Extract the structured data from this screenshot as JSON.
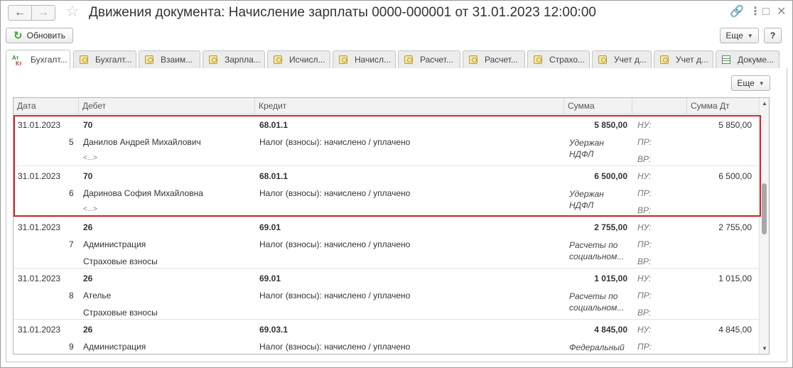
{
  "window": {
    "title": "Движения документа: Начисление зарплаты 0000-000001 от 31.01.2023 12:00:00",
    "back_icon": "arrow-left-icon",
    "forward_icon": "arrow-right-icon",
    "favorite_icon": "star-icon",
    "link_icon": "link-icon",
    "menu_icon": "more-vertical-icon",
    "maximize_icon": "maximize-icon",
    "close_icon": "close-icon"
  },
  "toolbar": {
    "refresh_label": "Обновить",
    "more_label": "Еще",
    "help_label": "?"
  },
  "tabs": [
    {
      "label": "Бухгалт...",
      "icon": "at-kt-icon",
      "active": true
    },
    {
      "label": "Бухгалт...",
      "icon": "register-icon"
    },
    {
      "label": "Взаим...",
      "icon": "register-icon"
    },
    {
      "label": "Зарпла...",
      "icon": "register-icon"
    },
    {
      "label": "Исчисл...",
      "icon": "register-icon"
    },
    {
      "label": "Начисл...",
      "icon": "register-icon"
    },
    {
      "label": "Расчет...",
      "icon": "register-icon"
    },
    {
      "label": "Расчет...",
      "icon": "register-icon"
    },
    {
      "label": "Страхо...",
      "icon": "register-icon"
    },
    {
      "label": "Учет д...",
      "icon": "register-icon"
    },
    {
      "label": "Учет д...",
      "icon": "register-icon"
    },
    {
      "label": "Докуме...",
      "icon": "table-icon"
    }
  ],
  "panel": {
    "more_label": "Еще"
  },
  "grid": {
    "columns": {
      "date": "Дата",
      "debit": "Дебет",
      "credit": "Кредит",
      "amount": "Сумма",
      "blank": "",
      "amount_dt": "Сумма Дт"
    },
    "rows": [
      {
        "date": "31.01.2023",
        "num": "5",
        "debit_account": "70",
        "debit_sub1": "Данилов Андрей Михайлович",
        "debit_sub2": "<...>",
        "credit_account": "68.01.1",
        "credit_sub1": "Налог (взносы): начислено / уплачено",
        "amount": "5 850,00",
        "content": "Удержан НДФЛ",
        "nu": "НУ:",
        "pr": "ПР:",
        "vr": "ВР:",
        "amount_dt": "5 850,00"
      },
      {
        "date": "31.01.2023",
        "num": "6",
        "debit_account": "70",
        "debit_sub1": "Даринова София Михайловна",
        "debit_sub2": "<...>",
        "credit_account": "68.01.1",
        "credit_sub1": "Налог (взносы): начислено / уплачено",
        "amount": "6 500,00",
        "content": "Удержан НДФЛ",
        "nu": "НУ:",
        "pr": "ПР:",
        "vr": "ВР:",
        "amount_dt": "6 500,00"
      },
      {
        "date": "31.01.2023",
        "num": "7",
        "debit_account": "26",
        "debit_sub1": "Администрация",
        "debit_sub2": "Страховые взносы",
        "credit_account": "69.01",
        "credit_sub1": "Налог (взносы): начислено / уплачено",
        "amount": "2 755,00",
        "content": "Расчеты по социальном...",
        "nu": "НУ:",
        "pr": "ПР:",
        "vr": "ВР:",
        "amount_dt": "2 755,00"
      },
      {
        "date": "31.01.2023",
        "num": "8",
        "debit_account": "26",
        "debit_sub1": "Ателье",
        "debit_sub2": "Страховые взносы",
        "credit_account": "69.01",
        "credit_sub1": "Налог (взносы): начислено / уплачено",
        "amount": "1 015,00",
        "content": "Расчеты по социальном...",
        "nu": "НУ:",
        "pr": "ПР:",
        "vr": "ВР:",
        "amount_dt": "1 015,00"
      },
      {
        "date": "31.01.2023",
        "num": "9",
        "debit_account": "26",
        "debit_sub1": "Администрация",
        "debit_sub2": "",
        "credit_account": "69.03.1",
        "credit_sub1": "Налог (взносы): начислено / уплачено",
        "amount": "4 845,00",
        "content": "Федеральный фонд ОМС",
        "nu": "НУ:",
        "pr": "ПР:",
        "vr": "",
        "amount_dt": "4 845,00"
      }
    ]
  },
  "colors": {
    "highlight": "#d9232b",
    "refresh_icon": "#3aa33a"
  }
}
